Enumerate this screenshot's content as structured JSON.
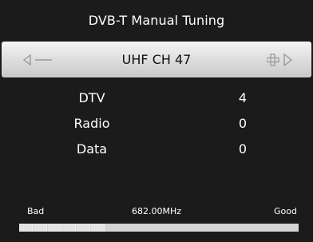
{
  "title": "DVB-T Manual Tuning",
  "channel": {
    "name": "UHF CH 47",
    "prev_icon": "left-arrow-minus-icon",
    "next_icon": "plus-right-arrow-icon"
  },
  "rows": [
    {
      "label": "DTV",
      "value": "4"
    },
    {
      "label": "Radio",
      "value": "0"
    },
    {
      "label": "Data",
      "value": "0"
    }
  ],
  "signal": {
    "bad_label": "Bad",
    "frequency": "682.00MHz",
    "good_label": "Good",
    "level_fraction": 0.31,
    "segments": 6
  },
  "colors": {
    "background": "#1b1b1b",
    "selected_bar": "#dcdcdc",
    "text": "#ffffff"
  }
}
